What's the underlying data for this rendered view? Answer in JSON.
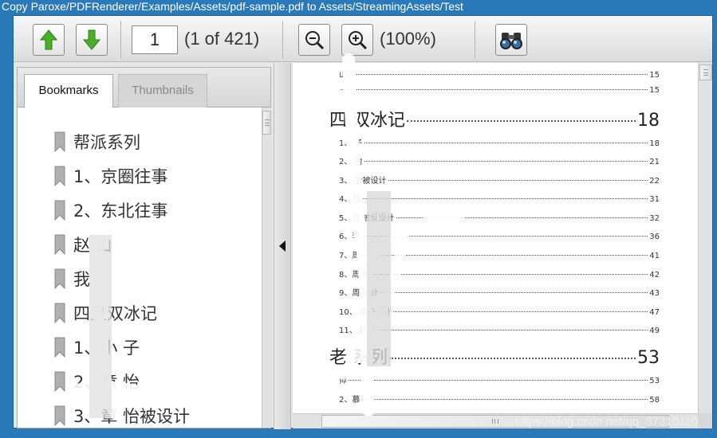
{
  "window": {
    "title": "Copy Paroxe/PDFRenderer/Examples/Assets/pdf-sample.pdf to Assets/StreamingAssets/Test"
  },
  "toolbar": {
    "page_input": "1",
    "page_count": "(1 of 421)",
    "zoom_level": "(100%)",
    "icons": [
      "arrow-up-icon",
      "arrow-down-icon",
      "zoom-out-icon",
      "zoom-in-icon",
      "binoculars-icon"
    ]
  },
  "sidebar": {
    "tabs": [
      {
        "label": "Bookmarks",
        "active": true
      },
      {
        "label": "Thumbnails",
        "active": false
      }
    ],
    "bookmarks": [
      "帮派系列",
      "1、京圈往事",
      "2、东北往事",
      "赵  山",
      "我  ",
      "四旦双冰记",
      "1、小  子",
      "2、章  怡",
      "3、章  怡被设计"
    ]
  },
  "document": {
    "toc": [
      {
        "label": "山",
        "page": "15",
        "level": "sub"
      },
      {
        "label": "",
        "page": "15",
        "level": "sub"
      },
      {
        "label": "四  双冰记",
        "page": "18",
        "level": "main"
      },
      {
        "label": "1、   子",
        "page": "18",
        "level": "sub"
      },
      {
        "label": "2、   怡",
        "page": "21",
        "level": "sub"
      },
      {
        "label": "3、   怡被设计",
        "page": "22",
        "level": "sub"
      },
      {
        "label": "4、范   ",
        "page": "31",
        "level": "sub"
      },
      {
        "label": "5、范   被反设计",
        "page": "32",
        "level": "sub"
      },
      {
        "label": "6、李   ",
        "page": "36",
        "level": "sub"
      },
      {
        "label": "7、周   ",
        "page": "41",
        "level": "sub"
      },
      {
        "label": "8、周   瘦",
        "page": "42",
        "level": "sub"
      },
      {
        "label": "9、周   设计",
        "page": "43",
        "level": "sub"
      },
      {
        "label": "10、   燕子设计",
        "page": "47",
        "level": "sub"
      },
      {
        "label": "11、   回击",
        "page": "49",
        "level": "sub"
      },
      {
        "label": "老   系列",
        "page": "53",
        "level": "main"
      },
      {
        "label": "   师",
        "page": "53",
        "level": "sub"
      },
      {
        "label": "2、慕   ",
        "page": "58",
        "level": "sub"
      }
    ]
  },
  "watermark": "https://blog.csdn.net/qq_37310110",
  "colors": {
    "background": "#2a79b8",
    "toolbar_arrow": "#4caf2a"
  }
}
